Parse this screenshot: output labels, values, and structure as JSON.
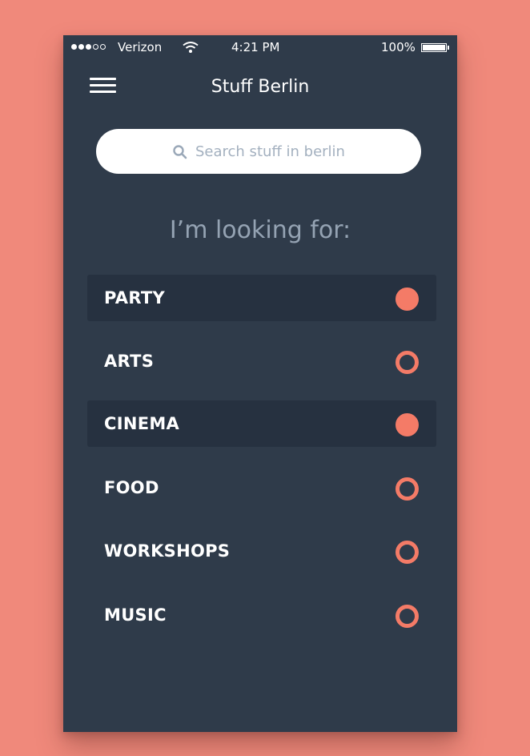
{
  "status_bar": {
    "carrier": "Verizon",
    "time": "4:21 PM",
    "battery": "100%"
  },
  "header": {
    "title": "Stuff Berlin",
    "menu_icon": "hamburger-menu-icon"
  },
  "search": {
    "placeholder": "Search stuff in berlin",
    "icon": "search-icon"
  },
  "prompt": "I’m looking for:",
  "categories": [
    {
      "label": "PARTY",
      "selected": true
    },
    {
      "label": "ARTS",
      "selected": false
    },
    {
      "label": "CINEMA",
      "selected": true
    },
    {
      "label": "FOOD",
      "selected": false
    },
    {
      "label": "WORKSHOPS",
      "selected": false
    },
    {
      "label": "MUSIC",
      "selected": false
    }
  ],
  "colors": {
    "background": "#f0897b",
    "panel": "#2f3b4a",
    "selected_row": "#263140",
    "accent": "#f47b67",
    "prompt_text": "#95a3b3"
  }
}
